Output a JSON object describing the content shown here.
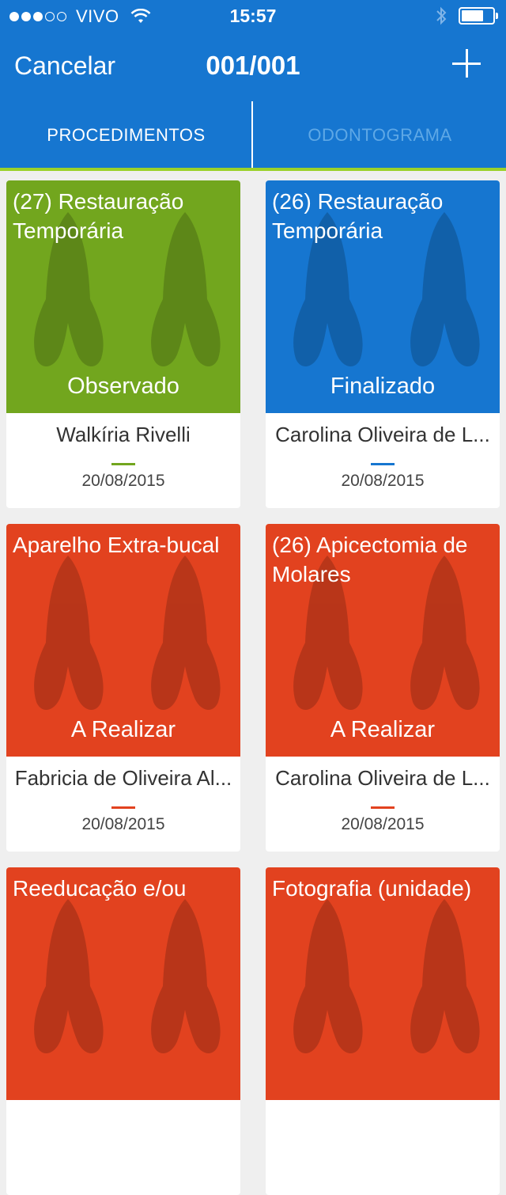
{
  "status_bar": {
    "carrier": "VIVO",
    "time": "15:57",
    "signal_filled": 3,
    "signal_total": 5,
    "battery_level": 0.7
  },
  "nav": {
    "cancel_label": "Cancelar",
    "title": "001/001",
    "add_icon": "plus-icon"
  },
  "tabs": [
    {
      "label": "PROCEDIMENTOS",
      "active": true
    },
    {
      "label": "ODONTOGRAMA",
      "active": false
    }
  ],
  "colors": {
    "header": "#1676d0",
    "tab_indicator": "#9bd12b",
    "observado": "#72a61e",
    "finalizado": "#1676d0",
    "a_realizar": "#e2421f"
  },
  "procedures": [
    {
      "title": "(27) Restauração Temporária",
      "status": "Observado",
      "color": "#72a61e",
      "patient": "Walkíria Rivelli",
      "date": "20/08/2015"
    },
    {
      "title": "(26) Restauração Temporária",
      "status": "Finalizado",
      "color": "#1676d0",
      "patient": "Carolina Oliveira de L...",
      "date": "20/08/2015"
    },
    {
      "title": "Aparelho Extra-bucal",
      "status": "A Realizar",
      "color": "#e2421f",
      "patient": "Fabricia de Oliveira Al...",
      "date": "20/08/2015"
    },
    {
      "title": "(26) Apicectomia de Molares",
      "status": "A Realizar",
      "color": "#e2421f",
      "patient": "Carolina Oliveira de L...",
      "date": "20/08/2015"
    },
    {
      "title": "Reeducação e/ou",
      "status": "",
      "color": "#e2421f",
      "patient": "",
      "date": ""
    },
    {
      "title": "Fotografia (unidade)",
      "status": "",
      "color": "#e2421f",
      "patient": "",
      "date": ""
    }
  ]
}
